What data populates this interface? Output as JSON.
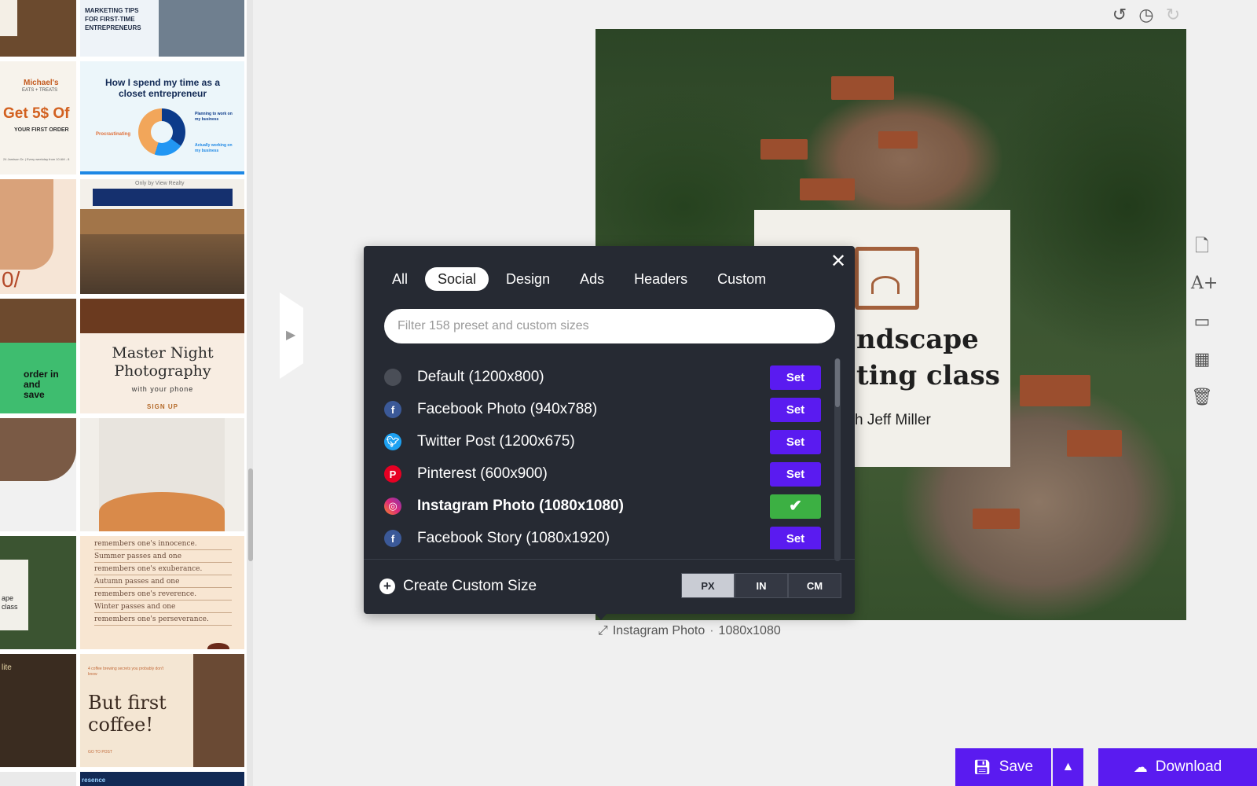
{
  "gallery": {
    "marketing_tips": "MARKETING TIPS FOR FIRST-TIME ENTREPRENEURS",
    "michaels_brand": "Michael's",
    "michaels_sub": "EATS + TREATS",
    "get5_headline": "Get 5$ Of",
    "get5_sub": "YOUR FIRST ORDER",
    "get5_foot": "24 Jamison Dr. | Every weekday from 10 AM - 8",
    "closet_title": "How I spend my time as a closet entrepreneur",
    "closet_legend_a": "Planning to work on my business",
    "closet_legend_b": "Procrastinating",
    "closet_legend_c": "Actually working on my business",
    "realty_caption": "Only by View Realty",
    "percent_partial": "0/",
    "order_text": "order in and save",
    "night_title": "Master Night Photography",
    "night_sub": "with your phone",
    "night_cta": "SIGN UP",
    "poem_lines": [
      "remembers one's innocence.",
      "Summer passes and one",
      "remembers one's exuberance.",
      "Autumn passes and one",
      "remembers one's reverence.",
      "Winter passes and one",
      "remembers one's perseverance."
    ],
    "landscape_partial": "ape class",
    "coffee_small": "4 coffee brewing secrets you probably don't know",
    "coffee_title": "But first coffee!",
    "coffee_cta": "GO TO POST",
    "presence_partial": "resence",
    "lite_partial": "lite"
  },
  "history": {
    "undo_icon": "undo-icon",
    "history_icon": "history-clock-icon",
    "redo_icon": "redo-icon"
  },
  "artboard": {
    "card_line1": "ndscape",
    "card_line2": "ting class",
    "card_line3": "h Jeff Miller",
    "caption_name": "Instagram Photo",
    "caption_size": "1080x1080"
  },
  "popup": {
    "tabs": [
      "All",
      "Social",
      "Design",
      "Ads",
      "Headers",
      "Custom"
    ],
    "active_tab": "Social",
    "filter_placeholder": "Filter 158 preset and custom sizes",
    "presets": [
      {
        "label": "Default (1200x800)",
        "icon": "default-dot-icon",
        "icon_color": "#4a4e57",
        "button": "Set",
        "selected": false
      },
      {
        "label": "Facebook Photo (940x788)",
        "icon": "facebook-icon",
        "icon_color": "#3b5998",
        "button": "Set",
        "selected": false
      },
      {
        "label": "Twitter Post (1200x675)",
        "icon": "twitter-icon",
        "icon_color": "#1da1f2",
        "button": "Set",
        "selected": false
      },
      {
        "label": "Pinterest (600x900)",
        "icon": "pinterest-icon",
        "icon_color": "#e60023",
        "button": "Set",
        "selected": false
      },
      {
        "label": "Instagram Photo (1080x1080)",
        "icon": "instagram-icon",
        "icon_color": "#d6249f",
        "button": "✔",
        "selected": true
      },
      {
        "label": "Facebook Story (1080x1920)",
        "icon": "facebook-icon",
        "icon_color": "#3b5998",
        "button": "Set",
        "selected": false
      }
    ],
    "create_custom": "Create Custom Size",
    "units": [
      "PX",
      "IN",
      "CM"
    ],
    "active_unit": "PX"
  },
  "bottom": {
    "save_label": "Save",
    "download_label": "Download"
  },
  "colors": {
    "accent": "#5a1bf0",
    "popup_bg": "#262a33",
    "selected_green": "#3cb043"
  }
}
